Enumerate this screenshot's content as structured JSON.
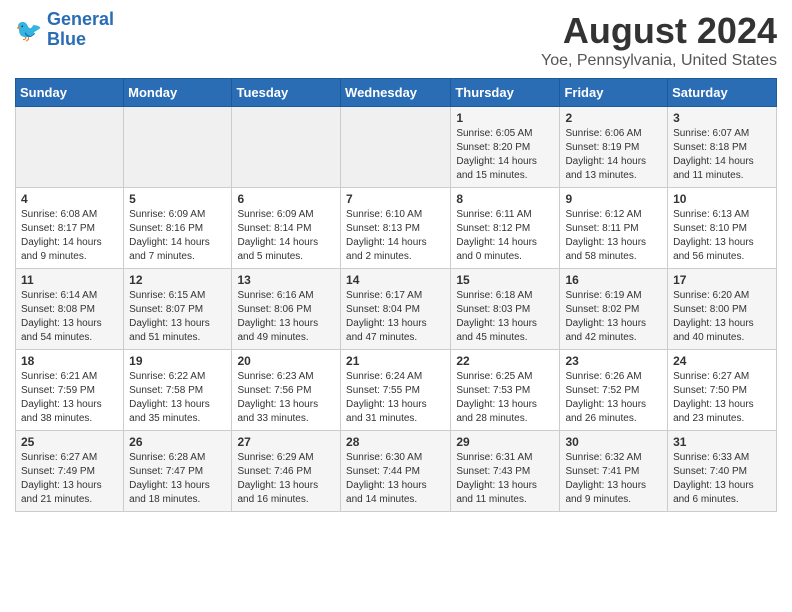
{
  "logo": {
    "line1": "General",
    "line2": "Blue"
  },
  "title": "August 2024",
  "subtitle": "Yoe, Pennsylvania, United States",
  "weekdays": [
    "Sunday",
    "Monday",
    "Tuesday",
    "Wednesday",
    "Thursday",
    "Friday",
    "Saturday"
  ],
  "weeks": [
    [
      {
        "day": "",
        "info": ""
      },
      {
        "day": "",
        "info": ""
      },
      {
        "day": "",
        "info": ""
      },
      {
        "day": "",
        "info": ""
      },
      {
        "day": "1",
        "info": "Sunrise: 6:05 AM\nSunset: 8:20 PM\nDaylight: 14 hours\nand 15 minutes."
      },
      {
        "day": "2",
        "info": "Sunrise: 6:06 AM\nSunset: 8:19 PM\nDaylight: 14 hours\nand 13 minutes."
      },
      {
        "day": "3",
        "info": "Sunrise: 6:07 AM\nSunset: 8:18 PM\nDaylight: 14 hours\nand 11 minutes."
      }
    ],
    [
      {
        "day": "4",
        "info": "Sunrise: 6:08 AM\nSunset: 8:17 PM\nDaylight: 14 hours\nand 9 minutes."
      },
      {
        "day": "5",
        "info": "Sunrise: 6:09 AM\nSunset: 8:16 PM\nDaylight: 14 hours\nand 7 minutes."
      },
      {
        "day": "6",
        "info": "Sunrise: 6:09 AM\nSunset: 8:14 PM\nDaylight: 14 hours\nand 5 minutes."
      },
      {
        "day": "7",
        "info": "Sunrise: 6:10 AM\nSunset: 8:13 PM\nDaylight: 14 hours\nand 2 minutes."
      },
      {
        "day": "8",
        "info": "Sunrise: 6:11 AM\nSunset: 8:12 PM\nDaylight: 14 hours\nand 0 minutes."
      },
      {
        "day": "9",
        "info": "Sunrise: 6:12 AM\nSunset: 8:11 PM\nDaylight: 13 hours\nand 58 minutes."
      },
      {
        "day": "10",
        "info": "Sunrise: 6:13 AM\nSunset: 8:10 PM\nDaylight: 13 hours\nand 56 minutes."
      }
    ],
    [
      {
        "day": "11",
        "info": "Sunrise: 6:14 AM\nSunset: 8:08 PM\nDaylight: 13 hours\nand 54 minutes."
      },
      {
        "day": "12",
        "info": "Sunrise: 6:15 AM\nSunset: 8:07 PM\nDaylight: 13 hours\nand 51 minutes."
      },
      {
        "day": "13",
        "info": "Sunrise: 6:16 AM\nSunset: 8:06 PM\nDaylight: 13 hours\nand 49 minutes."
      },
      {
        "day": "14",
        "info": "Sunrise: 6:17 AM\nSunset: 8:04 PM\nDaylight: 13 hours\nand 47 minutes."
      },
      {
        "day": "15",
        "info": "Sunrise: 6:18 AM\nSunset: 8:03 PM\nDaylight: 13 hours\nand 45 minutes."
      },
      {
        "day": "16",
        "info": "Sunrise: 6:19 AM\nSunset: 8:02 PM\nDaylight: 13 hours\nand 42 minutes."
      },
      {
        "day": "17",
        "info": "Sunrise: 6:20 AM\nSunset: 8:00 PM\nDaylight: 13 hours\nand 40 minutes."
      }
    ],
    [
      {
        "day": "18",
        "info": "Sunrise: 6:21 AM\nSunset: 7:59 PM\nDaylight: 13 hours\nand 38 minutes."
      },
      {
        "day": "19",
        "info": "Sunrise: 6:22 AM\nSunset: 7:58 PM\nDaylight: 13 hours\nand 35 minutes."
      },
      {
        "day": "20",
        "info": "Sunrise: 6:23 AM\nSunset: 7:56 PM\nDaylight: 13 hours\nand 33 minutes."
      },
      {
        "day": "21",
        "info": "Sunrise: 6:24 AM\nSunset: 7:55 PM\nDaylight: 13 hours\nand 31 minutes."
      },
      {
        "day": "22",
        "info": "Sunrise: 6:25 AM\nSunset: 7:53 PM\nDaylight: 13 hours\nand 28 minutes."
      },
      {
        "day": "23",
        "info": "Sunrise: 6:26 AM\nSunset: 7:52 PM\nDaylight: 13 hours\nand 26 minutes."
      },
      {
        "day": "24",
        "info": "Sunrise: 6:27 AM\nSunset: 7:50 PM\nDaylight: 13 hours\nand 23 minutes."
      }
    ],
    [
      {
        "day": "25",
        "info": "Sunrise: 6:27 AM\nSunset: 7:49 PM\nDaylight: 13 hours\nand 21 minutes."
      },
      {
        "day": "26",
        "info": "Sunrise: 6:28 AM\nSunset: 7:47 PM\nDaylight: 13 hours\nand 18 minutes."
      },
      {
        "day": "27",
        "info": "Sunrise: 6:29 AM\nSunset: 7:46 PM\nDaylight: 13 hours\nand 16 minutes."
      },
      {
        "day": "28",
        "info": "Sunrise: 6:30 AM\nSunset: 7:44 PM\nDaylight: 13 hours\nand 14 minutes."
      },
      {
        "day": "29",
        "info": "Sunrise: 6:31 AM\nSunset: 7:43 PM\nDaylight: 13 hours\nand 11 minutes."
      },
      {
        "day": "30",
        "info": "Sunrise: 6:32 AM\nSunset: 7:41 PM\nDaylight: 13 hours\nand 9 minutes."
      },
      {
        "day": "31",
        "info": "Sunrise: 6:33 AM\nSunset: 7:40 PM\nDaylight: 13 hours\nand 6 minutes."
      }
    ]
  ]
}
